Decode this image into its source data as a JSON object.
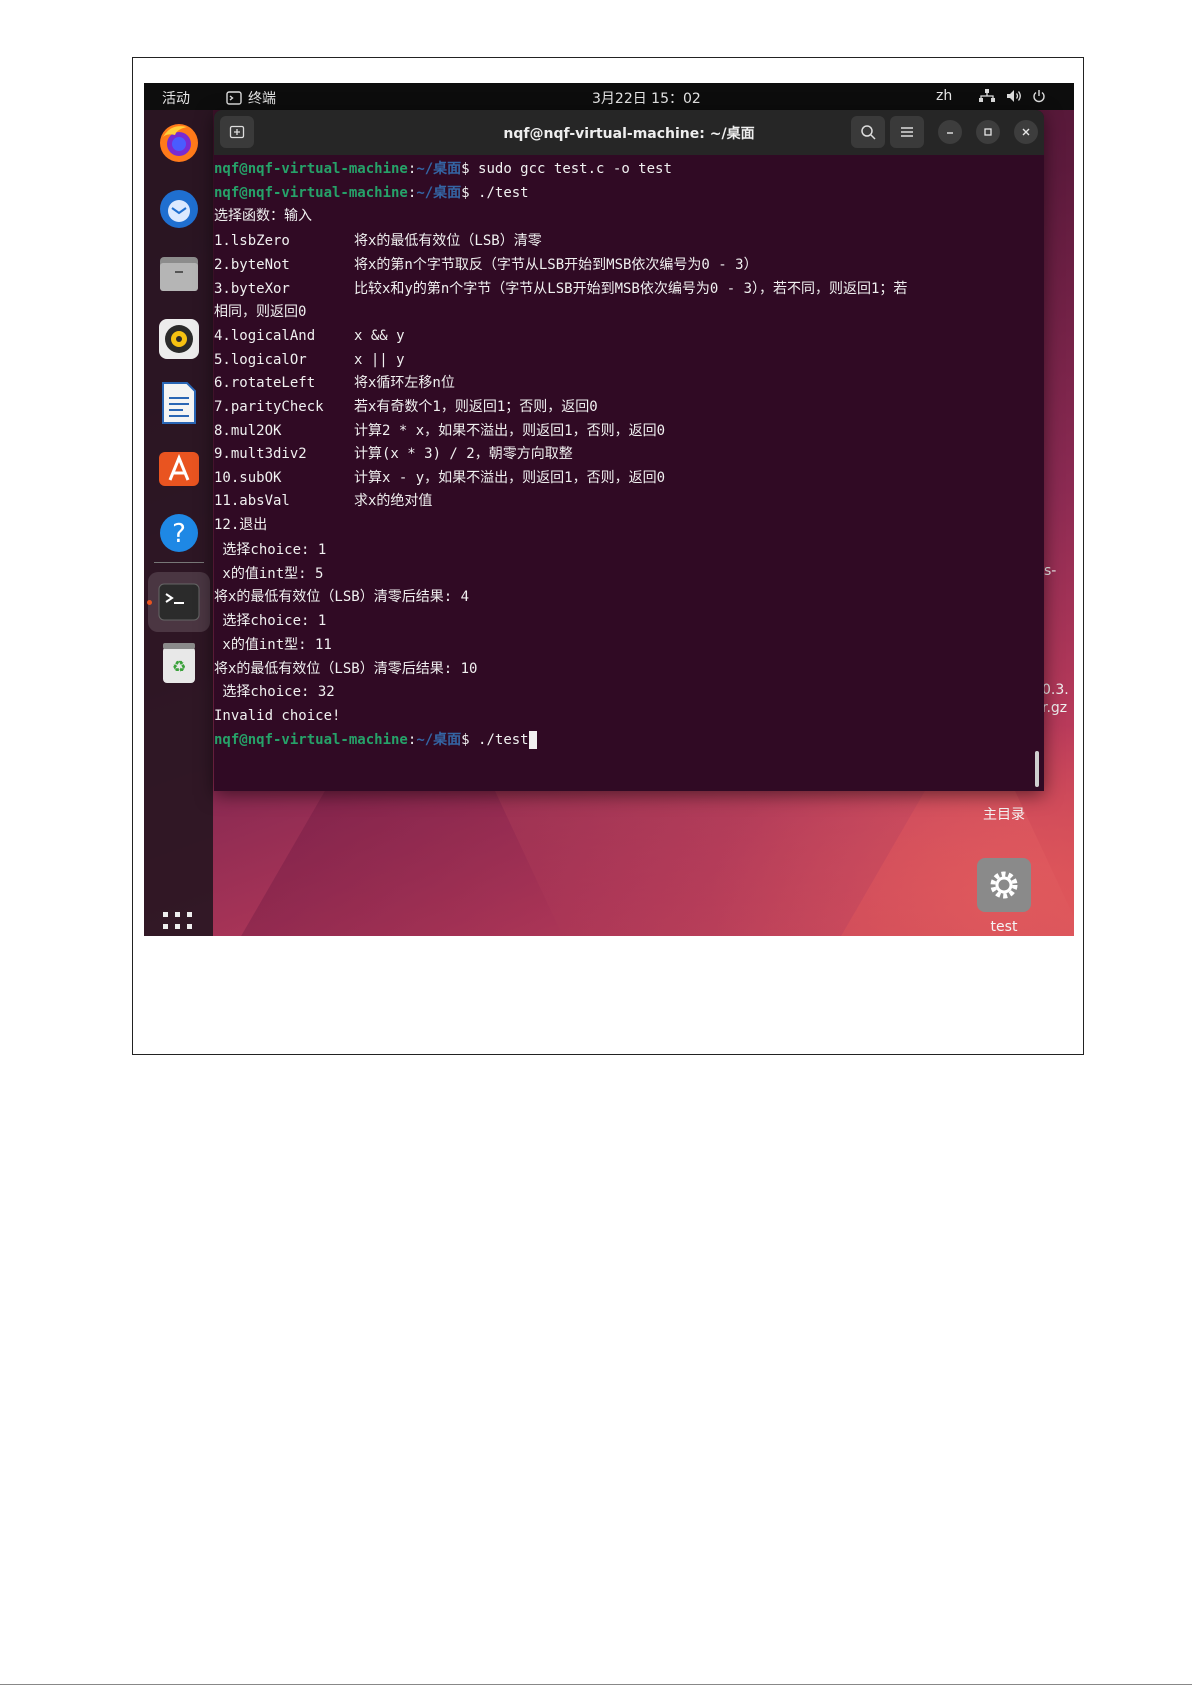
{
  "topbar": {
    "activities": "活动",
    "app_name": "终端",
    "datetime": "3月22日 15：02",
    "lang": "zh"
  },
  "terminal": {
    "title": "nqf@nqf-virtual-machine: ~/桌面",
    "prompt_user": "nqf@nqf-virtual-machine",
    "prompt_sep": ":",
    "prompt_path": "~/桌面",
    "prompt_dollar": "$",
    "lines": [
      {
        "type": "cmd",
        "text": " sudo gcc test.c -o test"
      },
      {
        "type": "cmd",
        "text": " ./test"
      },
      {
        "type": "text",
        "text": "选择函数：输入"
      },
      {
        "type": "menu",
        "a": "1.lsbZero",
        "b": "将x的最低有效位（LSB）清零"
      },
      {
        "type": "menu",
        "a": "2.byteNot",
        "b": "将x的第n个字节取反（字节从LSB开始到MSB依次编号为0 - 3）"
      },
      {
        "type": "menu",
        "a": "3.byteXor",
        "b": "比较x和y的第n个字节（字节从LSB开始到MSB依次编号为0 - 3），若不同，则返回1；若"
      },
      {
        "type": "text",
        "text": "相同，则返回0"
      },
      {
        "type": "menu",
        "a": "4.logicalAnd",
        "b": "x && y"
      },
      {
        "type": "menu",
        "a": "5.logicalOr",
        "b": "x || y"
      },
      {
        "type": "menu",
        "a": "6.rotateLeft",
        "b": "将x循环左移n位"
      },
      {
        "type": "menu",
        "a": "7.parityCheck",
        "b": "若x有奇数个1，则返回1；否则，返回0"
      },
      {
        "type": "menu",
        "a": "8.mul2OK",
        "b": "计算2 * x，如果不溢出，则返回1，否则，返回0"
      },
      {
        "type": "menu",
        "a": "9.mult3div2",
        "b": "计算(x * 3) / 2，朝零方向取整"
      },
      {
        "type": "menu",
        "a": "10.subOK",
        "b": "计算x - y，如果不溢出，则返回1，否则，返回0"
      },
      {
        "type": "menu",
        "a": "11.absVal",
        "b": "求x的绝对值"
      },
      {
        "type": "text",
        "text": "12.退出"
      },
      {
        "type": "text",
        "text": " 选择choice: 1"
      },
      {
        "type": "text",
        "text": " x的值int型: 5"
      },
      {
        "type": "text",
        "text": "将x的最低有效位（LSB）清零后结果: 4"
      },
      {
        "type": "text",
        "text": " 选择choice: 1"
      },
      {
        "type": "text",
        "text": " x的值int型: 11"
      },
      {
        "type": "text",
        "text": "将x的最低有效位（LSB）清零后结果: 10"
      },
      {
        "type": "text",
        "text": " 选择choice: 32"
      },
      {
        "type": "text",
        "text": "Invalid choice!"
      },
      {
        "type": "cmdcursor",
        "text": " ./test"
      }
    ]
  },
  "desktop": {
    "home_label": "主目录",
    "test_label": "test",
    "frag1": "s-",
    "frag2": "0.3.",
    "frag3": "r.gz"
  },
  "dock_items": [
    "firefox-icon",
    "thunderbird-icon",
    "files-icon",
    "rhythmbox-icon",
    "writer-icon",
    "app-center-icon",
    "help-icon",
    "terminal-icon",
    "trash-icon"
  ]
}
